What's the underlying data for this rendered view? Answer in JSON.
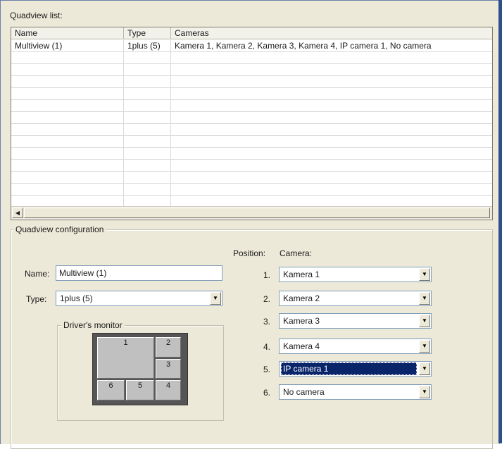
{
  "list_section": {
    "title": "Quadview list:"
  },
  "list": {
    "columns": [
      "Name",
      "Type",
      "Cameras"
    ],
    "rows": [
      {
        "name": "Multiview (1)",
        "type": "1plus (5)",
        "cameras": "Kamera 1, Kamera 2, Kamera 3, Kamera 4, IP camera 1, No camera"
      }
    ],
    "scroll_left_glyph": "◀"
  },
  "config": {
    "title": "Quadview configuration",
    "name_label": "Name:",
    "name_value": "Multiview (1)",
    "type_label": "Type:",
    "type_value": "1plus (5)",
    "position_label": "Position:",
    "camera_label": "Camera:",
    "dropdown_glyph": "▼",
    "positions": [
      {
        "num": "1.",
        "camera": "Kamera 1"
      },
      {
        "num": "2.",
        "camera": "Kamera 2"
      },
      {
        "num": "3.",
        "camera": "Kamera 3"
      },
      {
        "num": "4.",
        "camera": "Kamera 4"
      },
      {
        "num": "5.",
        "camera": "IP camera 1"
      },
      {
        "num": "6.",
        "camera": "No camera"
      }
    ]
  },
  "monitor": {
    "title": "Driver's monitor",
    "cells": [
      "1",
      "2",
      "3",
      "4",
      "5",
      "6"
    ]
  }
}
